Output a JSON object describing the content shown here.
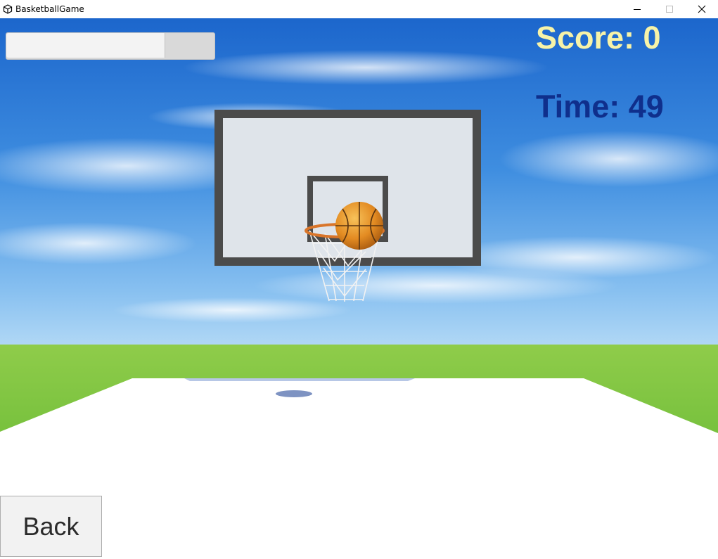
{
  "window": {
    "title": "BasketballGame",
    "app_icon": "unity-icon",
    "controls": [
      "minimize-icon",
      "maximize-icon",
      "close-icon"
    ]
  },
  "hud": {
    "score_text": "Score: 0",
    "time_text": "Time: 49",
    "power_slider_value": 0.76
  },
  "back_button": {
    "label": "Back"
  },
  "colors": {
    "score": "#f7f3a8",
    "time": "#0f2f8c",
    "sky_top": "#1f6fd0",
    "grass": "#6fbf35",
    "backboard_frame": "#4a4a4a",
    "backboard_panel": "#dfe4ea",
    "ball": "#e08a1f",
    "rim": "#d9752a"
  }
}
